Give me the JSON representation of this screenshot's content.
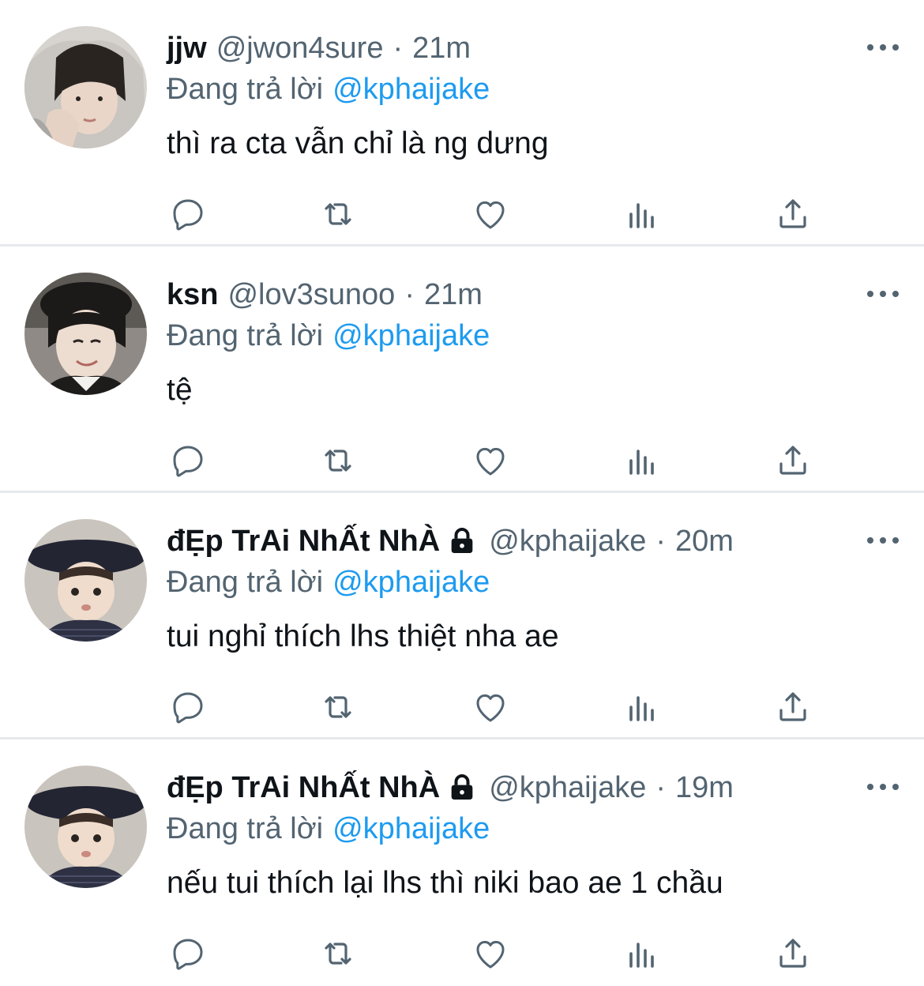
{
  "colors": {
    "secondary_text": "#536471",
    "mention": "#1d9bf0",
    "divider": "#e6e9ec"
  },
  "tweets": [
    {
      "name": "jjw",
      "handle": "@jwon4sure",
      "separator": "·",
      "time": "21m",
      "protected": false,
      "reply_prefix": "Đang trả lời",
      "reply_to": "@kphaijake",
      "text": "thì ra cta vẫn chỉ là ng dưng",
      "avatar": "avatar-photo-hooded-person"
    },
    {
      "name": "ksn",
      "handle": "@lov3sunoo",
      "separator": "·",
      "time": "21m",
      "protected": false,
      "reply_prefix": "Đang trả lời",
      "reply_to": "@kphaijake",
      "text": "tệ",
      "avatar": "avatar-photo-person-in-cap"
    },
    {
      "name": "đẸp TrAi NhẤt NhÀ",
      "handle": "@kphaijake",
      "separator": "·",
      "time": "20m",
      "protected": true,
      "reply_prefix": "Đang trả lời",
      "reply_to": "@kphaijake",
      "text": "tui nghỉ thích lhs thiệt nha ae",
      "avatar": "avatar-photo-child-in-hat"
    },
    {
      "name": "đẸp TrAi NhẤt NhÀ",
      "handle": "@kphaijake",
      "separator": "·",
      "time": "19m",
      "protected": true,
      "reply_prefix": "Đang trả lời",
      "reply_to": "@kphaijake",
      "text": "nếu tui thích lại lhs thì niki bao ae 1 chầu",
      "avatar": "avatar-photo-child-in-hat"
    }
  ]
}
